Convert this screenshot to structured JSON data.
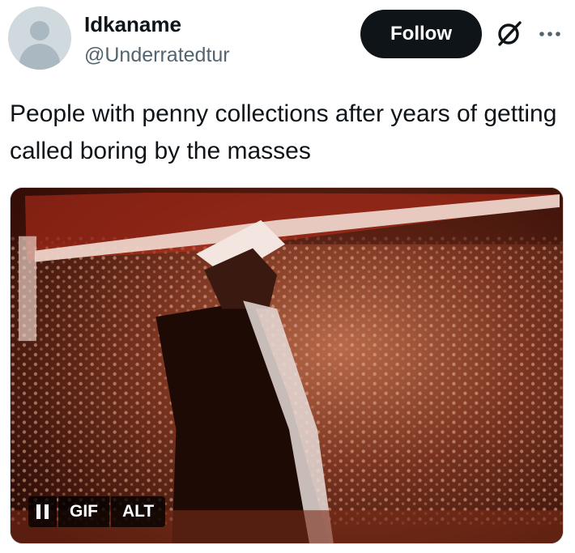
{
  "author": {
    "display_name": "Idkaname",
    "handle": "@Underratedtur"
  },
  "actions": {
    "follow_label": "Follow"
  },
  "tweet": {
    "text": "People with penny collections after years of getting called boring by the masses"
  },
  "media": {
    "type": "gif",
    "gif_label": "GIF",
    "alt_label": "ALT",
    "playback": "playing"
  },
  "icons": {
    "grok": "grok-icon",
    "more": "more-dots-icon",
    "pause": "pause-icon",
    "avatar": "default-avatar-icon"
  },
  "colors": {
    "follow_bg": "#0f1419",
    "handle": "#536471",
    "text": "#0f1419"
  }
}
